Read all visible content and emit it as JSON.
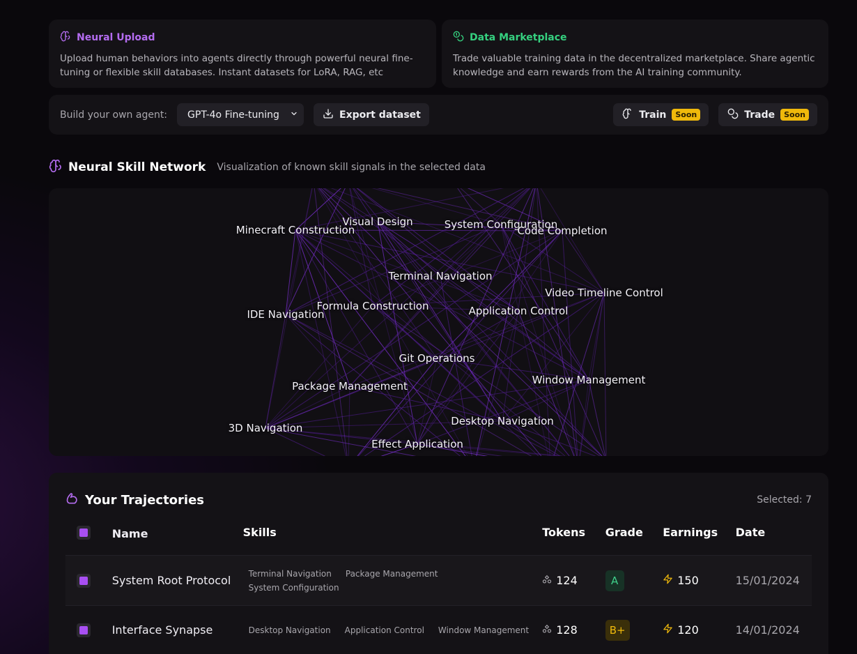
{
  "neural_upload": {
    "title": "Neural Upload",
    "description": "Upload human behaviors into agents directly through powerful neural fine-tuning or flexible skill databases. Instant datasets for LoRA, RAG, etc"
  },
  "data_marketplace": {
    "title": "Data Marketplace",
    "description": "Trade valuable training data in the decentralized marketplace. Share agentic knowledge and earn rewards from the AI training community."
  },
  "toolbar": {
    "build_label": "Build your own agent:",
    "model_select": "GPT-4o Fine-tuning",
    "export_label": "Export dataset",
    "train_label": "Train",
    "trade_label": "Trade",
    "soon_badge": "Soon"
  },
  "network": {
    "title": "Neural Skill Network",
    "subtitle": "Visualization of known skill signals in the selected data",
    "nodes": [
      "Minecraft Construction",
      "Visual Design",
      "System Configuration",
      "Code Completion",
      "Terminal Navigation",
      "Video Timeline Control",
      "IDE Navigation",
      "Formula Construction",
      "Application Control",
      "Git Operations",
      "Window Management",
      "Package Management",
      "3D Navigation",
      "Desktop Navigation",
      "Effect Application"
    ]
  },
  "trajectories": {
    "title": "Your Trajectories",
    "selected": "Selected: 7",
    "columns": {
      "name": "Name",
      "skills": "Skills",
      "tokens": "Tokens",
      "grade": "Grade",
      "earnings": "Earnings",
      "date": "Date"
    },
    "rows": [
      {
        "name": "System Root Protocol",
        "skills": [
          "Terminal Navigation",
          "Package Management",
          "System Configuration"
        ],
        "tokens": "124",
        "grade": "A",
        "earnings": "150",
        "date": "15/01/2024"
      },
      {
        "name": "Interface Synapse",
        "skills": [
          "Desktop Navigation",
          "Application Control",
          "Window Management"
        ],
        "tokens": "128",
        "grade": "B+",
        "earnings": "120",
        "date": "14/01/2024"
      }
    ]
  },
  "colors": {
    "accent_purple": "#b46cf0",
    "accent_green": "#35d07f",
    "soon_yellow": "#f0b90b"
  }
}
